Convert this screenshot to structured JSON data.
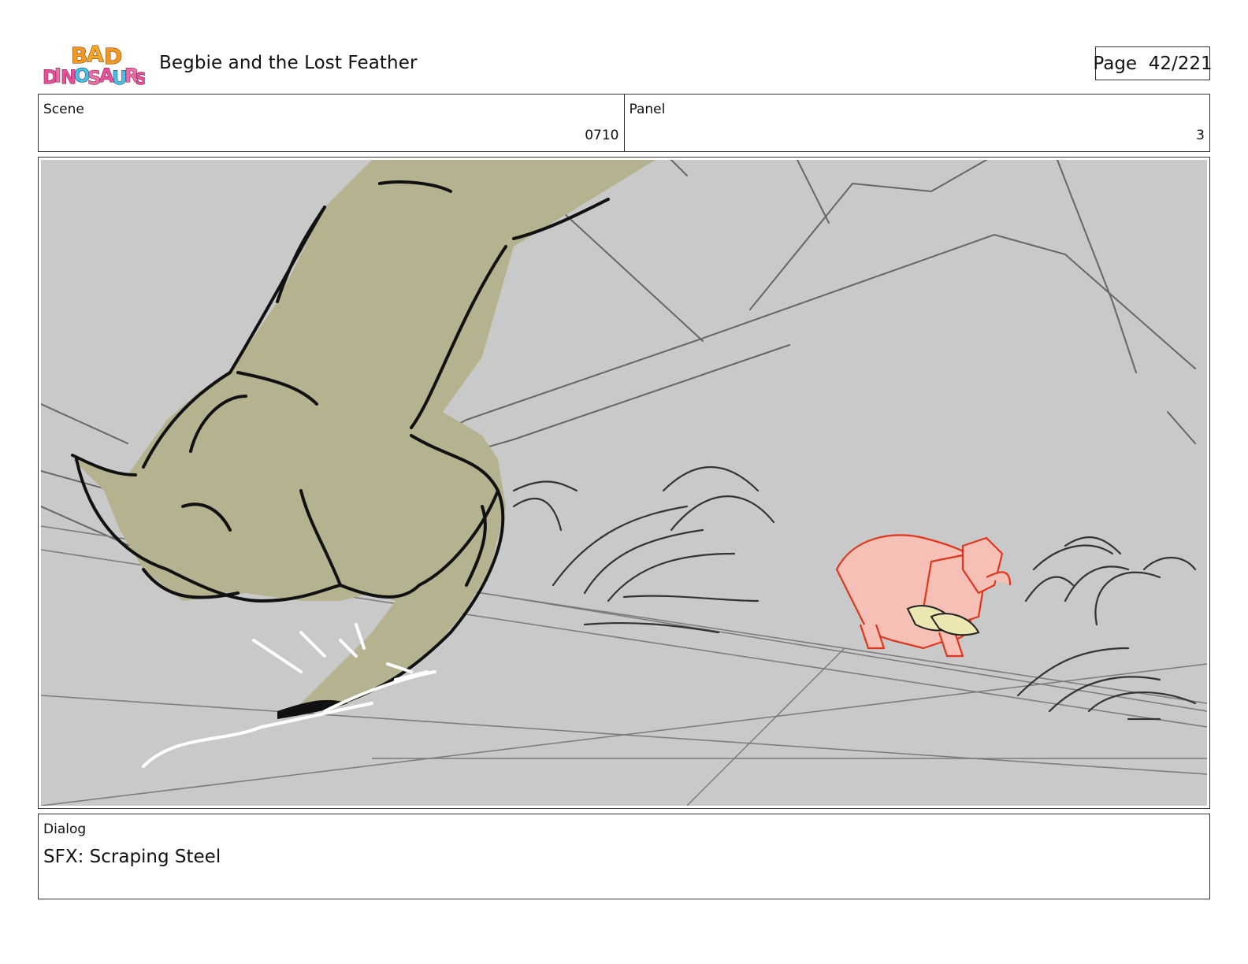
{
  "header": {
    "logo_text": "BAD DINOSAURS",
    "title": "Begbie and the Lost Feather",
    "page_label": "Page  42/221"
  },
  "info": {
    "scene_label": "Scene",
    "scene_value": "0710",
    "panel_label": "Panel",
    "panel_value": "3"
  },
  "dialog": {
    "label": "Dialog",
    "text": "SFX: Scraping Steel"
  }
}
